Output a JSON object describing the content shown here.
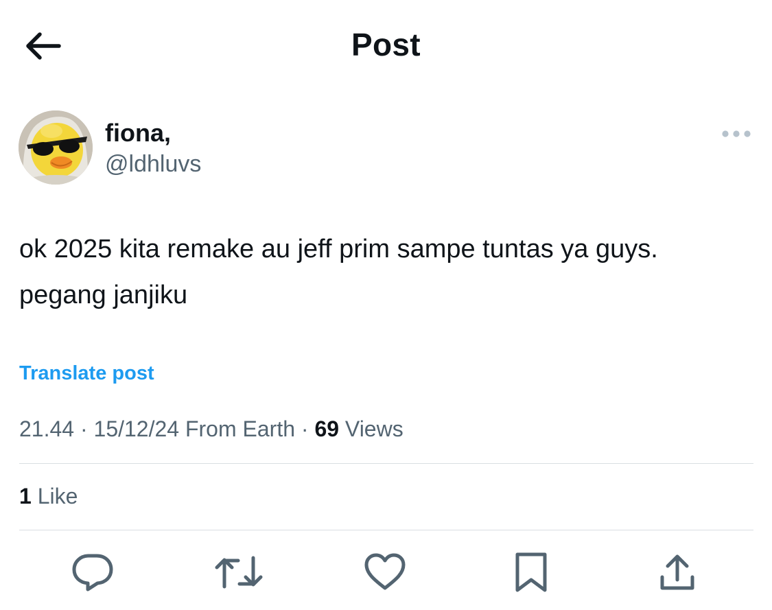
{
  "header": {
    "title": "Post",
    "back_icon": "arrow-left-icon"
  },
  "author": {
    "display_name": "fiona,",
    "handle": "@ldhluvs",
    "more_icon": "more-horizontal-icon"
  },
  "post": {
    "text": "ok 2025 kita remake au jeff prim sampe tuntas ya guys. pegang janjiku",
    "translate_label": "Translate post"
  },
  "meta": {
    "time": "21.44",
    "separator1": " · ",
    "date": "15/12/24",
    "source": " From Earth",
    "separator2": " · ",
    "views_count": "69",
    "views_label": " Views"
  },
  "stats": {
    "likes_count": "1",
    "likes_label": " Like"
  },
  "actions": {
    "items": [
      "reply-icon",
      "repost-icon",
      "like-icon",
      "bookmark-icon",
      "share-icon"
    ]
  },
  "colors": {
    "text": "#0f1419",
    "secondary": "#536471",
    "accent": "#1d9bf0",
    "divider": "#d9dee2"
  }
}
